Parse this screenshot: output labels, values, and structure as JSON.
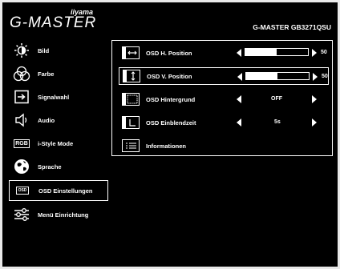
{
  "header": {
    "brand_small": "iiyama",
    "brand_big": "G-MASTER",
    "model": "G-MASTER GB3271QSU"
  },
  "sidebar": {
    "items": [
      {
        "label": "Bild",
        "icon": "brightness-icon"
      },
      {
        "label": "Farbe",
        "icon": "color-icon"
      },
      {
        "label": "Signalwahl",
        "icon": "input-icon"
      },
      {
        "label": "Audio",
        "icon": "speaker-icon"
      },
      {
        "label": "i-Style Mode",
        "icon": "rgb-icon",
        "icon_text": "RGB"
      },
      {
        "label": "Sprache",
        "icon": "globe-icon"
      },
      {
        "label": "OSD Einstellungen",
        "icon": "osd-icon",
        "icon_text": "OSD",
        "active": true
      },
      {
        "label": "Menü Einrichtung",
        "icon": "sliders-icon"
      }
    ]
  },
  "panel": {
    "rows": [
      {
        "label": "OSD H. Position",
        "icon": "h-position-icon",
        "value": "50",
        "level": 0.5
      },
      {
        "label": "OSD V. Position",
        "icon": "v-position-icon",
        "value": "50",
        "level": 0.5,
        "active": true
      },
      {
        "label": "OSD Hintergrund",
        "icon": "background-icon",
        "value": "OFF"
      },
      {
        "label": "OSD Einblendzeit",
        "icon": "timer-icon",
        "value": "5s"
      },
      {
        "label": "Informationen",
        "icon": "info-icon"
      }
    ]
  }
}
